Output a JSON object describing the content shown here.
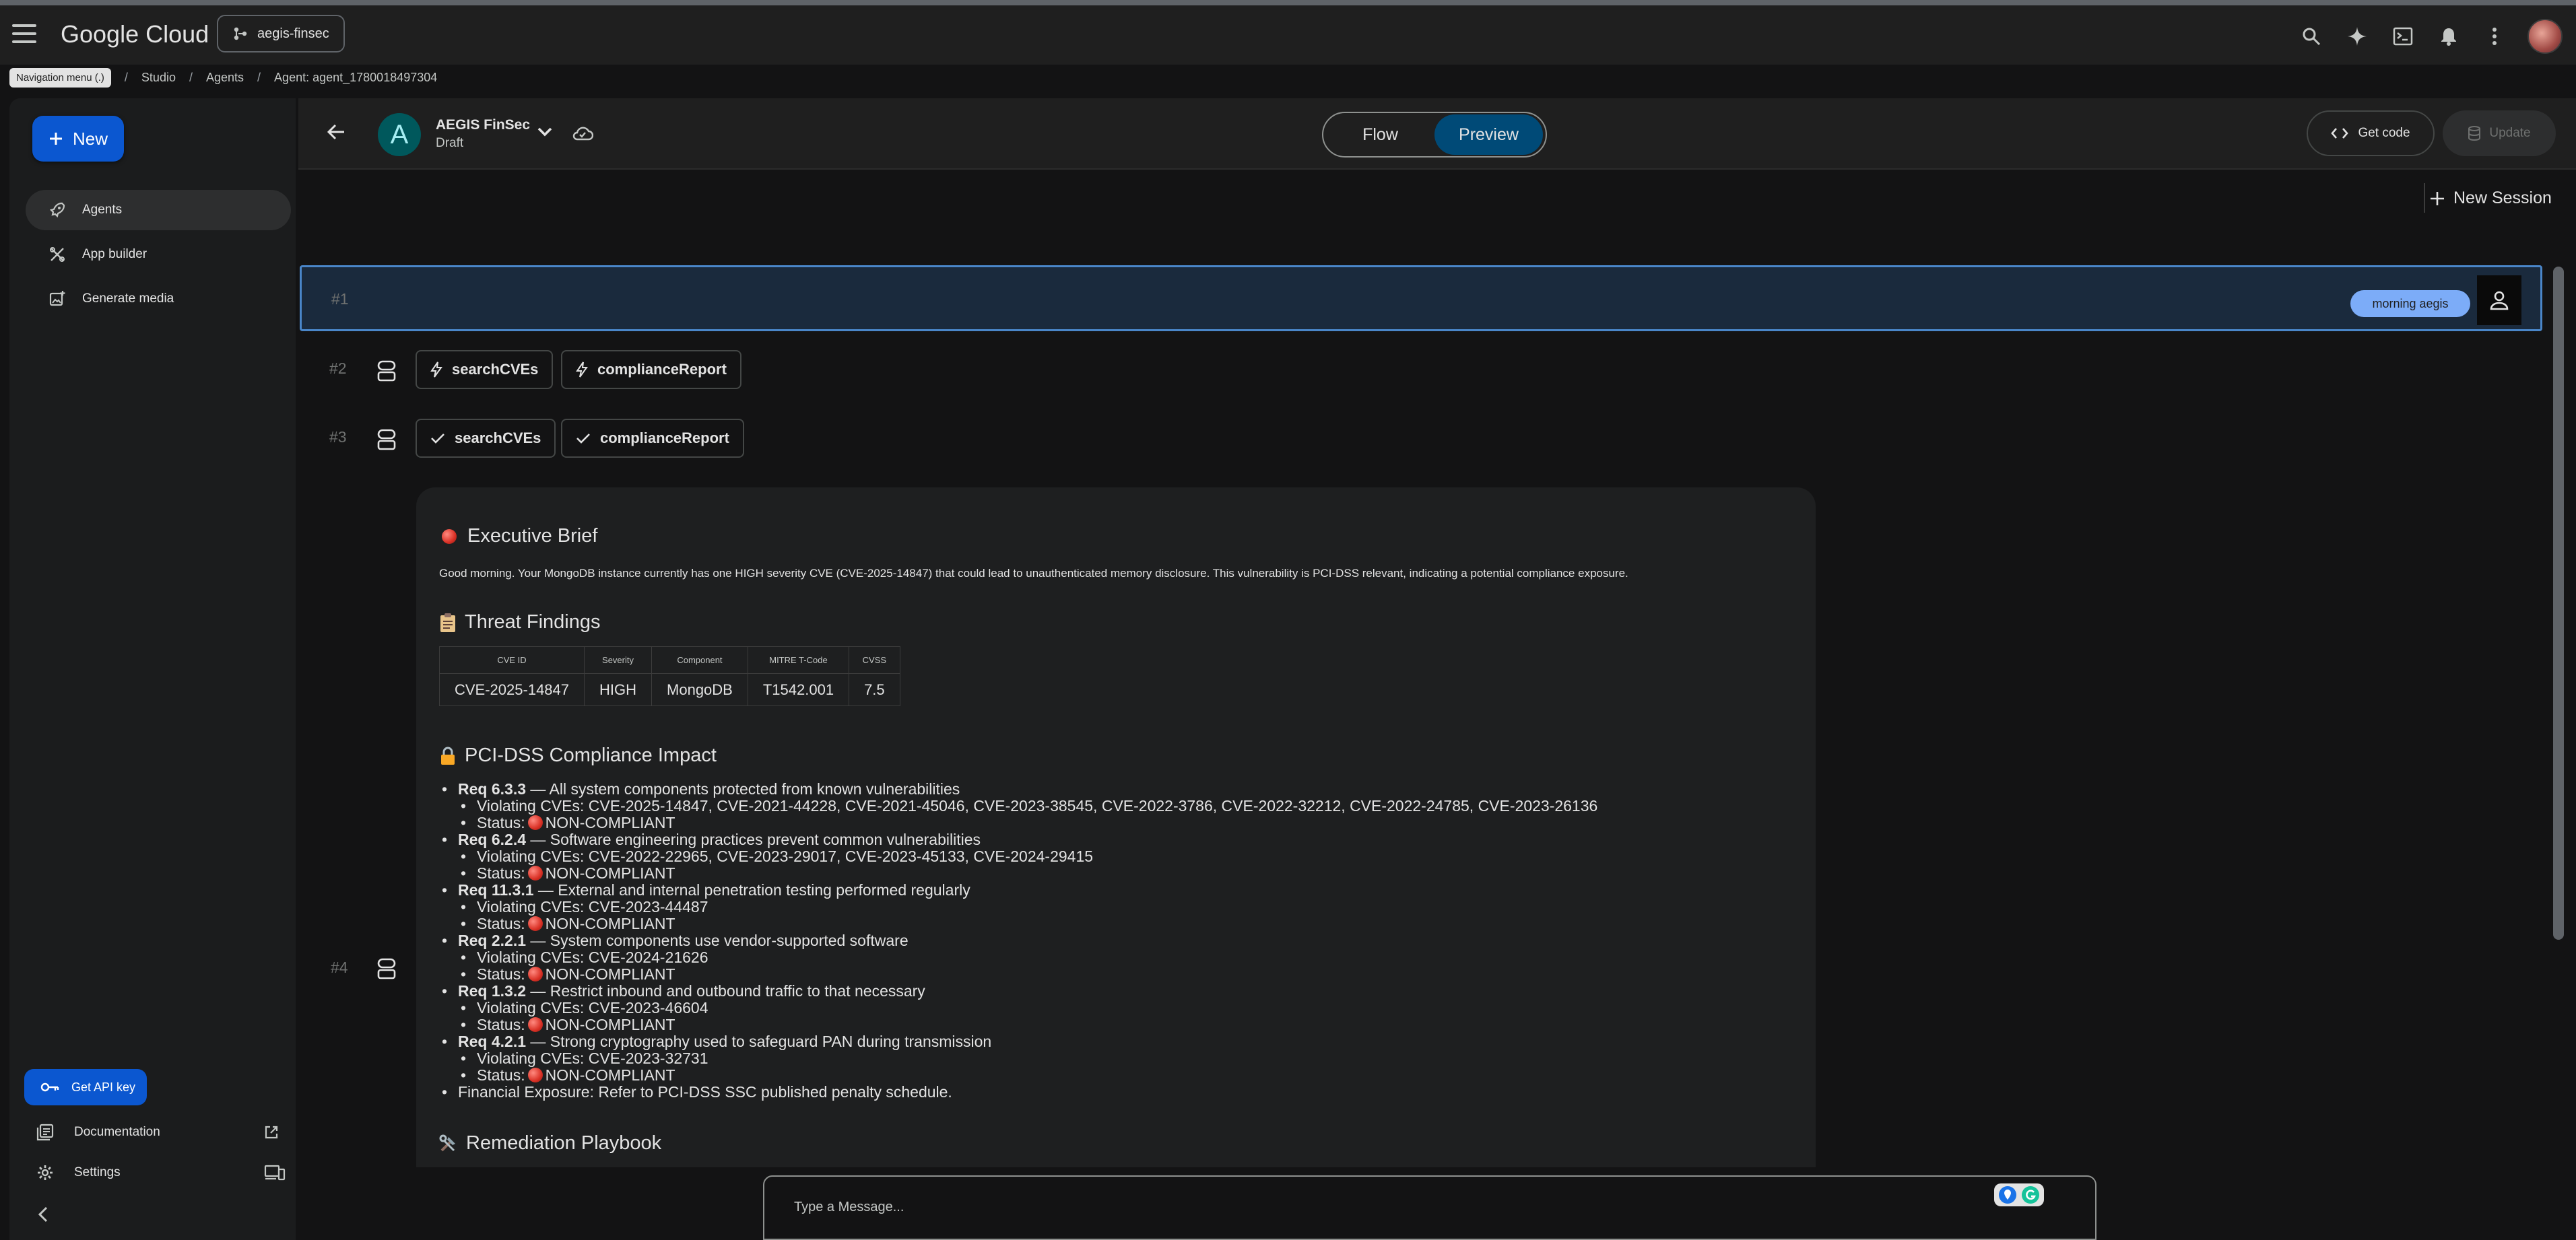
{
  "topbar": {
    "logo_text": "Google Cloud",
    "project_label": "aegis-finsec",
    "icons": [
      "search-icon",
      "gemini-spark-icon",
      "cloud-shell-icon",
      "notifications-icon",
      "more-vert-icon",
      "avatar"
    ]
  },
  "breadcrumb": {
    "tooltip": "Navigation menu (.)",
    "items": [
      "Studio",
      "Agents",
      "Agent: agent_1780018497304"
    ]
  },
  "sidebar": {
    "new_label": "New",
    "items": [
      {
        "label": "Agents",
        "icon": "rocket-icon",
        "active": true
      },
      {
        "label": "App builder",
        "icon": "tools-icon",
        "active": false
      },
      {
        "label": "Generate media",
        "icon": "add-photo-icon",
        "active": false
      }
    ],
    "api_key_label": "Get API key",
    "documentation_label": "Documentation",
    "settings_label": "Settings"
  },
  "agent": {
    "avatar_letter": "A",
    "name": "AEGIS FinSec",
    "status": "Draft",
    "tabs": [
      "Flow",
      "Preview"
    ],
    "selected_tab": "Preview",
    "get_code_label": "Get code",
    "update_label": "Update",
    "new_session_label": "New Session"
  },
  "conversation": {
    "row1": {
      "num": "#1",
      "user_message": "morning aegis"
    },
    "row2": {
      "num": "#2",
      "tools": [
        "searchCVEs",
        "complianceReport"
      ],
      "state": "running"
    },
    "row3": {
      "num": "#3",
      "tools": [
        "searchCVEs",
        "complianceReport"
      ],
      "state": "done"
    },
    "row4": {
      "num": "#4"
    }
  },
  "response": {
    "exec_title": "Executive Brief",
    "exec_body": "Good morning. Your MongoDB instance currently has one HIGH severity CVE (CVE-2025-14847) that could lead to unauthenticated memory disclosure. This vulnerability is PCI-DSS relevant, indicating a potential compliance exposure.",
    "threat_title": "Threat Findings",
    "table": {
      "headers": [
        "CVE ID",
        "Severity",
        "Component",
        "MITRE T-Code",
        "CVSS"
      ],
      "rows": [
        [
          "CVE-2025-14847",
          "HIGH",
          "MongoDB",
          "T1542.001",
          "7.5"
        ]
      ]
    },
    "pci_title": "PCI-DSS Compliance Impact",
    "reqs": [
      {
        "req": "Req 6.3.3",
        "desc": " — All system components protected from known vulnerabilities",
        "cves": "Violating CVEs: CVE-2025-14847, CVE-2021-44228, CVE-2021-45046, CVE-2023-38545, CVE-2022-3786, CVE-2022-32212, CVE-2022-24785, CVE-2023-26136",
        "status": "NON-COMPLIANT"
      },
      {
        "req": "Req 6.2.4",
        "desc": " — Software engineering practices prevent common vulnerabilities",
        "cves": "Violating CVEs: CVE-2022-22965, CVE-2023-29017, CVE-2023-45133, CVE-2024-29415",
        "status": "NON-COMPLIANT"
      },
      {
        "req": "Req 11.3.1",
        "desc": " — External and internal penetration testing performed regularly",
        "cves": "Violating CVEs: CVE-2023-44487",
        "status": "NON-COMPLIANT"
      },
      {
        "req": "Req 2.2.1",
        "desc": " — System components use vendor-supported software",
        "cves": "Violating CVEs: CVE-2024-21626",
        "status": "NON-COMPLIANT"
      },
      {
        "req": "Req 1.3.2",
        "desc": " — Restrict inbound and outbound traffic to that necessary",
        "cves": "Violating CVEs: CVE-2023-46604",
        "status": "NON-COMPLIANT"
      },
      {
        "req": "Req 4.2.1",
        "desc": " — Strong cryptography used to safeguard PAN during transmission",
        "cves": "Violating CVEs: CVE-2023-32731",
        "status": "NON-COMPLIANT"
      }
    ],
    "status_prefix": "Status:",
    "financial": "Financial Exposure: Refer to PCI-DSS SSC published penalty schedule.",
    "remediation_title": "Remediation Playbook"
  },
  "composer": {
    "placeholder": "Type a Message..."
  },
  "colors": {
    "accent": "#0b57d0",
    "selected_tab": "#004a77",
    "user_row_bg": "#1a2a3d",
    "user_chip": "#7cacf8",
    "status_red": "#d93025"
  }
}
